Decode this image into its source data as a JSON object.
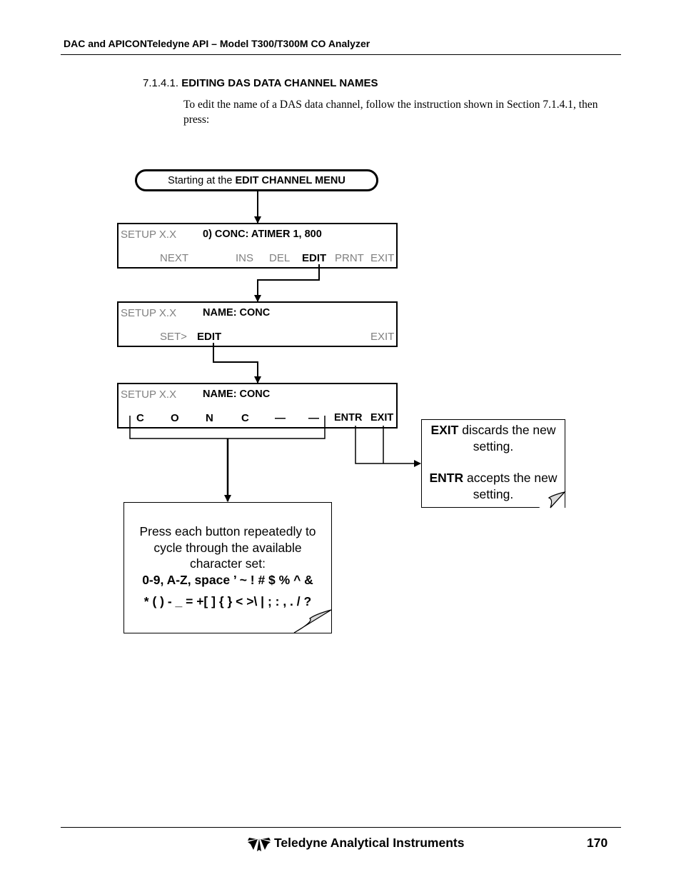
{
  "header": {
    "title": "DAC and APICONTeledyne API – Model T300/T300M CO Analyzer"
  },
  "section": {
    "number": "7.1.4.1.",
    "title": "EDITING DAS DATA CHANNEL NAMES",
    "intro": "To edit the name of a DAS data channel, follow the instruction shown in Section 7.1.4.1, then press:"
  },
  "flow": {
    "start": {
      "prefix": "Starting at the",
      "menu": "EDIT CHANNEL MENU"
    },
    "screen1": {
      "mode": "SETUP X.X",
      "message": "0) CONC:  ATIMER 1, 800",
      "buttons": [
        "NEXT",
        "INS",
        "DEL",
        "EDIT",
        "PRNT",
        "EXIT"
      ],
      "highlighted": "EDIT"
    },
    "screen2": {
      "mode": "SETUP X.X",
      "message": "NAME: CONC",
      "buttons": [
        "SET>",
        "EDIT",
        "EXIT"
      ],
      "highlighted": "EDIT"
    },
    "screen3": {
      "mode": "SETUP X.X",
      "message": "NAME: CONC",
      "buttons": [
        "C",
        "O",
        "N",
        "C",
        "—",
        "—",
        "ENTR",
        "EXIT"
      ]
    },
    "note_exit_entr": {
      "exit_key": "EXIT",
      "exit_text": "discards the new setting.",
      "entr_key": "ENTR",
      "entr_text": "accepts the new setting."
    },
    "note_charset": {
      "text": "Press each button repeatedly to cycle through the available character set:",
      "line1": "0-9, A-Z, space ’  ~ !  # $ % ^ &",
      "line2": "* ( ) - _ = +[ ] { } < >\\ | ; : , . / ?"
    }
  },
  "footer": {
    "brand": "Teledyne Analytical Instruments",
    "page": "170",
    "logo_icon": "teledyne-logo-icon"
  }
}
